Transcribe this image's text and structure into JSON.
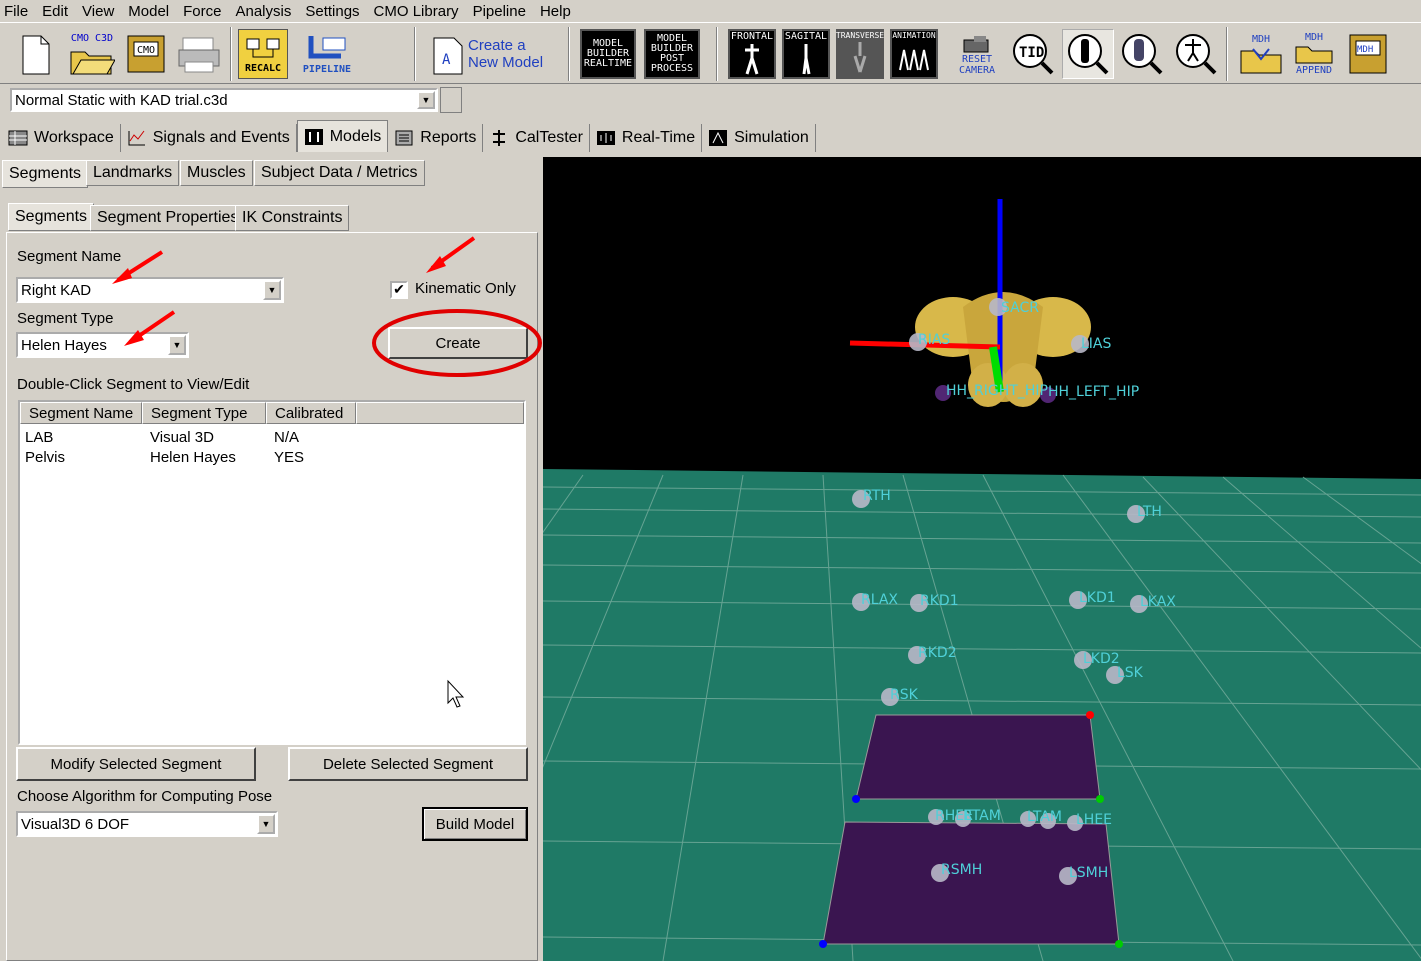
{
  "menu": [
    "File",
    "Edit",
    "View",
    "Model",
    "Force",
    "Analysis",
    "Settings",
    "CMO Library",
    "Pipeline",
    "Help"
  ],
  "toolbar": {
    "cmo_c3d": "CMO C3D",
    "cmo": "CMO",
    "recalc": "RECALC",
    "pipeline": "PIPELINE",
    "create_model_line1": "Create a",
    "create_model_line2": "New Model",
    "mb_realtime": [
      "MODEL",
      "BUILDER",
      "REALTIME"
    ],
    "mb_post": [
      "MODEL",
      "BUILDER",
      "POST",
      "PROCESS"
    ],
    "frontal": "FRONTAL",
    "sagital": "SAGITAL",
    "transverse": "TRANSVERSE",
    "animation": "ANIMATION",
    "reset_camera_line1": "RESET",
    "reset_camera_line2": "CAMERA",
    "tid": "TID",
    "mdh": "MDH",
    "mdh_append_top": "MDH",
    "mdh_append_bottom": "APPEND",
    "mdh_save": "MDH"
  },
  "file_combo": "Normal Static with KAD trial.c3d",
  "main_tabs": [
    "Workspace",
    "Signals and Events",
    "Models",
    "Reports",
    "CalTester",
    "Real-Time",
    "Simulation"
  ],
  "sub_tabs": [
    "Segments",
    "Landmarks",
    "Muscles",
    "Subject Data / Metrics"
  ],
  "inner_tabs": [
    "Segments",
    "Segment Properties",
    "IK Constraints"
  ],
  "segment_name_label": "Segment Name",
  "segment_name_value": "Right KAD",
  "kinematic_only_label": "Kinematic Only",
  "segment_type_label": "Segment Type",
  "segment_type_value": "Helen Hayes",
  "create_label": "Create",
  "list_label": "Double-Click Segment to View/Edit",
  "list_headers": [
    "Segment Name",
    "Segment Type",
    "Calibrated"
  ],
  "list_rows": [
    {
      "name": "LAB",
      "type": "Visual 3D",
      "calibrated": "N/A"
    },
    {
      "name": "Pelvis",
      "type": "Helen Hayes",
      "calibrated": "YES"
    }
  ],
  "modify_label": "Modify Selected Segment",
  "delete_label": "Delete Selected Segment",
  "algorithm_label": "Choose Algorithm for Computing Pose",
  "algorithm_value": "Visual3D 6 DOF",
  "build_label": "Build Model",
  "viewport_labels": [
    "SACR",
    "RIAS",
    "LIAS",
    "HH_RIGHT_HIP",
    "HH_LEFT_HIP",
    "RTH",
    "LTH",
    "RLAX",
    "RKD1",
    "LKD1",
    "LKAX",
    "RKD2",
    "LKD2",
    "LSK",
    "RSK",
    "RHEE",
    "RTAM",
    "LTAM",
    "LHEE",
    "RSMH",
    "LSMH"
  ],
  "colors": {
    "annotation": "#ff0000",
    "floor": "#1f7a66",
    "marker_label": "#4fd0d8",
    "plate": "#3a1550"
  }
}
